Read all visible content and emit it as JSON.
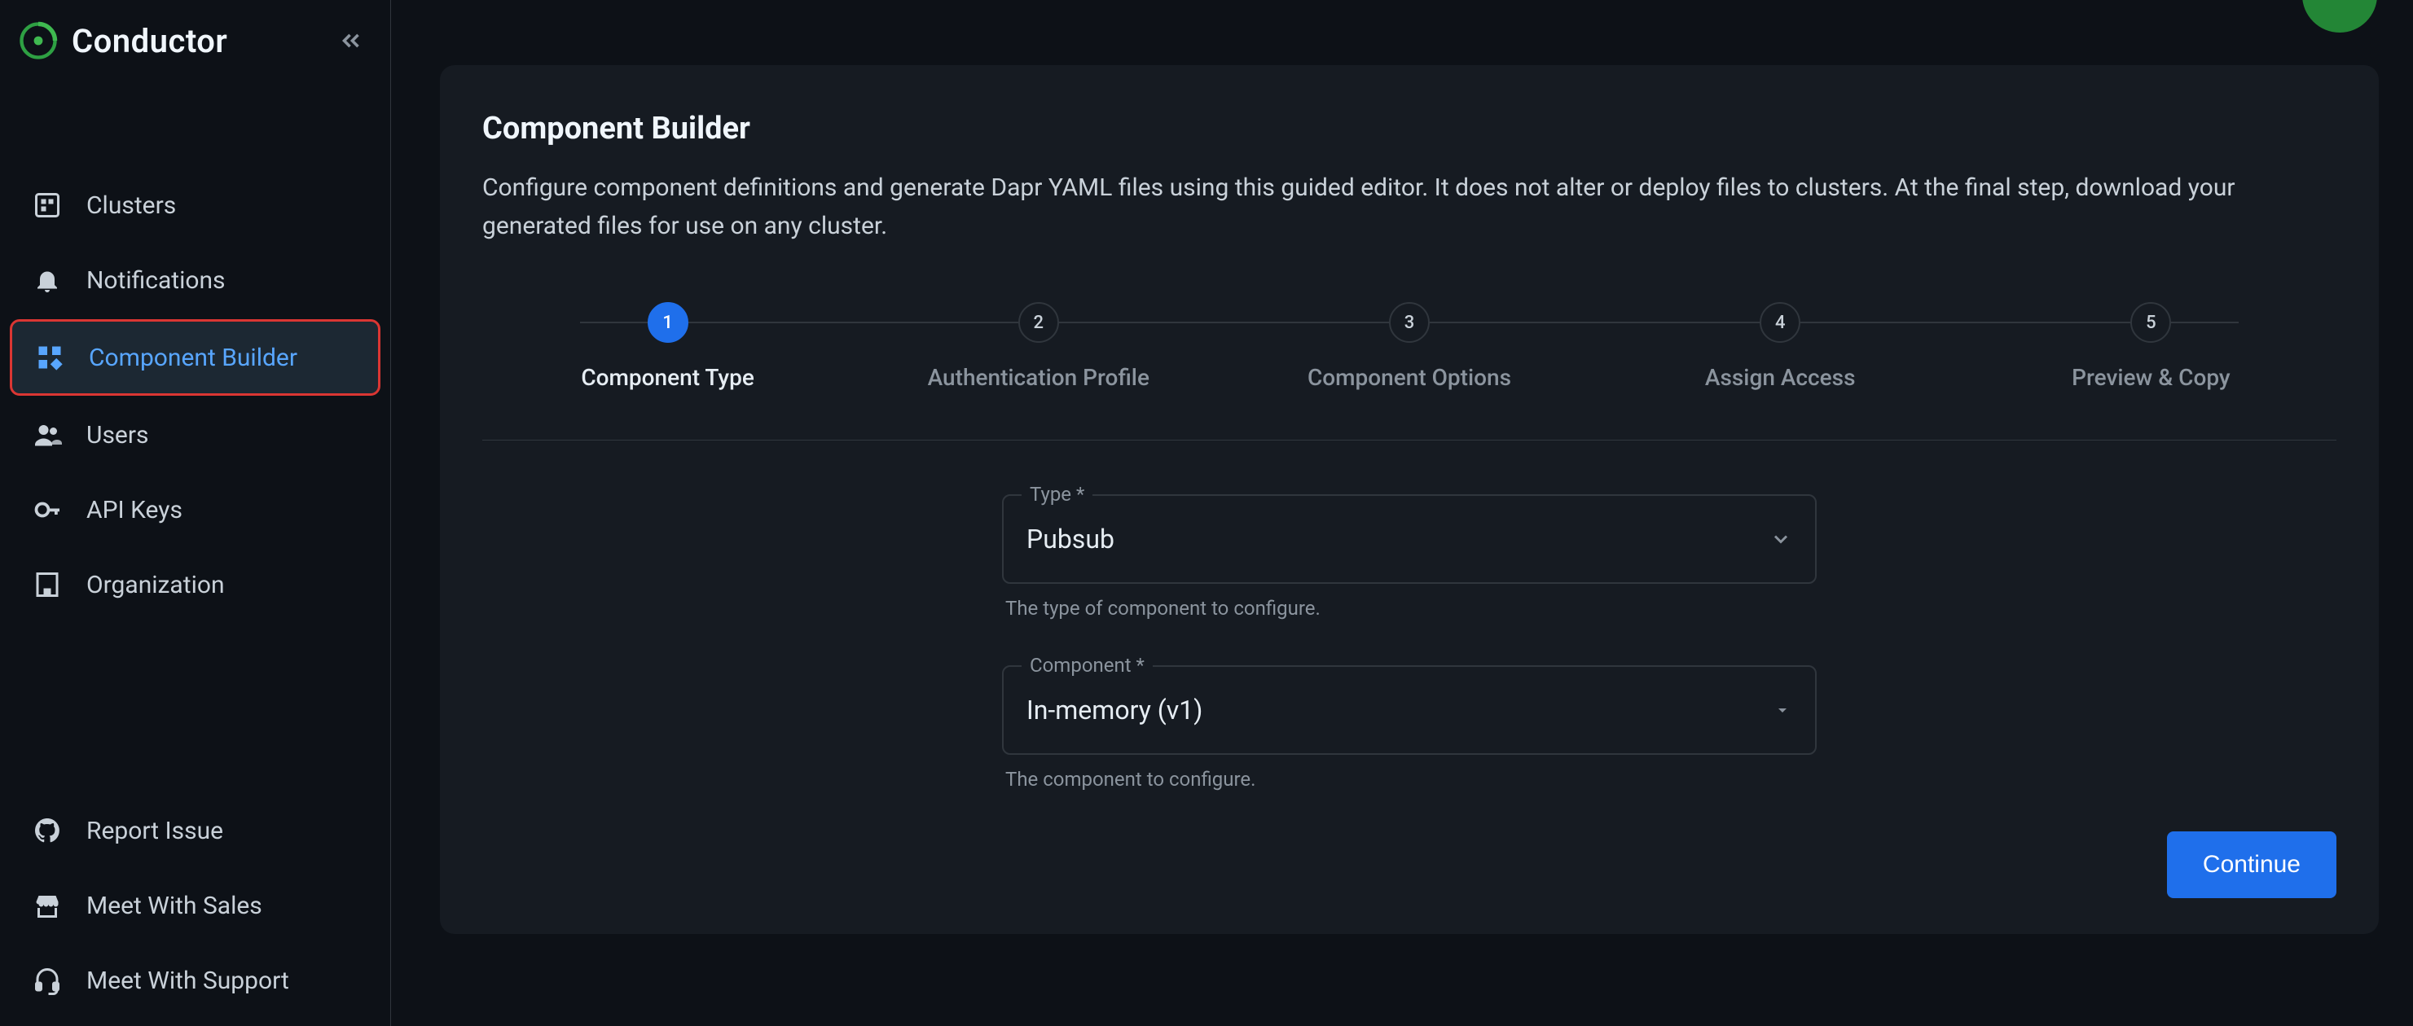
{
  "brand": {
    "name": "Conductor"
  },
  "sidebar": {
    "items": [
      {
        "label": "Clusters"
      },
      {
        "label": "Notifications"
      },
      {
        "label": "Component Builder"
      },
      {
        "label": "Users"
      },
      {
        "label": "API Keys"
      },
      {
        "label": "Organization"
      }
    ],
    "bottom": [
      {
        "label": "Report Issue"
      },
      {
        "label": "Meet With Sales"
      },
      {
        "label": "Meet With Support"
      }
    ]
  },
  "page": {
    "title": "Component Builder",
    "description": "Configure component definitions and generate Dapr YAML files using this guided editor. It does not alter or deploy files to clusters. At the final step, download your generated files for use on any cluster."
  },
  "stepper": {
    "active_index": 0,
    "steps": [
      {
        "num": "1",
        "label": "Component Type"
      },
      {
        "num": "2",
        "label": "Authentication Profile"
      },
      {
        "num": "3",
        "label": "Component Options"
      },
      {
        "num": "4",
        "label": "Assign Access"
      },
      {
        "num": "5",
        "label": "Preview & Copy"
      }
    ]
  },
  "form": {
    "type_field": {
      "label": "Type *",
      "value": "Pubsub",
      "helper": "The type of component to configure."
    },
    "component_field": {
      "label": "Component *",
      "value": "In-memory (v1)",
      "helper": "The component to configure."
    }
  },
  "actions": {
    "continue": "Continue"
  }
}
